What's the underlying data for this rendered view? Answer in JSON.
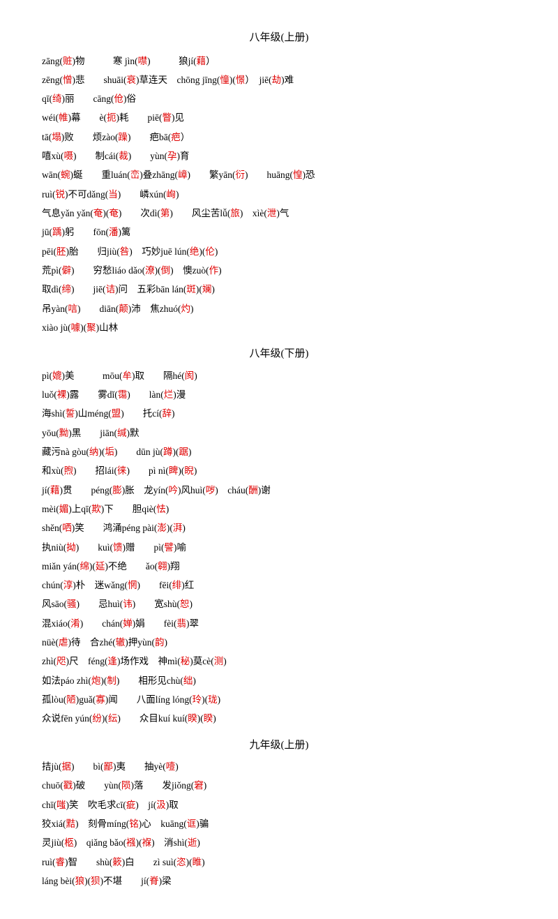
{
  "title1": "八年级(上册)",
  "title2": "八年级(下册)",
  "title3": "九年级(上册)",
  "lines_upper": [
    "zāng(<span class='red'>赃</span>)物　　　寒 jìn(<span class='red'>噤</span>)　　　狼jí(<span class='red'>藉</span>）",
    "zēng(<span class='red'>憎</span>)悲　　shuāi(<span class='red'>衰</span>)草连天　chōng jīng(<span class='red'>憧</span>)(<span class='red'>憬</span>）　jiē(<span class='red'>劫</span>)难",
    "qī(<span class='red'>绮</span>)丽　　cāng(<span class='red'>伧</span>)俗",
    "wéi(<span class='red'>帷</span>)幕　　è(<span class='red'>扼</span>)耗　　piē(<span class='red'>瞥</span>)见",
    "tā(<span class='red'>塌</span>)败　　烦zào(<span class='red'>躁</span>)　　疤bā(<span class='red'>疤</span>）",
    "嘻xù(<span class='red'>嗫</span>)　　制cái(<span class='red'>裁</span>)　　yùn(<span class='red'>孕</span>)育",
    "wān(<span class='red'>蜿</span>)蜒　　重luán(<span class='red'>峦</span>)叠zhāng(<span class='red'>嶂</span>)　　繁yān(<span class='red'>衍</span>)　　huāng(<span class='red'>惶</span>)恐",
    "ruì(<span class='red'>锐</span>)不可dǎng(<span class='red'>当</span>)　　嶙xún(<span class='red'>峋</span>)　",
    "气息yǎn yǎn(<span class='red'>奄</span>)(<span class='red'>奄</span>)　　次dì(<span class='red'>第</span>)　　风尘苦lǚ(<span class='red'>旅</span>)　xìè(<span class='red'>泄</span>)气",
    "jū(<span class='red'>踽</span>)躬　　fōn(<span class='red'>潘</span>)篱",
    "pēi(<span class='red'>胚</span>)胎　　归jiù(<span class='red'>咎</span>)　巧妙juē lún(<span class='red'>绝</span>)(<span class='red'>伦</span>)",
    "荒pì(<span class='red'>僻</span>)　　穷愁liáo dǎo(<span class='red'>潦</span>)(<span class='red'>倒</span>)　懊zuò(<span class='red'>作</span>)",
    "取dì(<span class='red'>缔</span>)　　jiē(<span class='red'>诘</span>)问　五彩bān lán(<span class='red'>斑</span>)(<span class='red'>斓</span>)",
    "吊yàn(<span class='red'>唁</span>)　　diān(<span class='red'>颠</span>)沛　焦zhuó(<span class='red'>灼</span>)",
    "xiào jù(<span class='red'>噱</span>)(<span class='red'>聚</span>)山林"
  ],
  "lines_lower": [
    "pì(<span class='red'>媲</span>)美　　　mōu(<span class='red'>牟</span>)取　　隔hé(<span class='red'>阂</span>)",
    "luǒ(<span class='red'>裸</span>)露　　雾dǐ(<span class='red'>霭</span>)　　làn(<span class='red'>烂</span>)漫",
    "海shì(<span class='red'>誓</span>)山méng(<span class='red'>盟</span>)　　托cí(<span class='red'>辞</span>)",
    "yōu(<span class='red'>黝</span>)黑　　jiān(<span class='red'>缄</span>)默",
    "藏污nà gòu(<span class='red'>纳</span>)(<span class='red'>垢</span>)　　dūn jù(<span class='red'>蹲</span>)(<span class='red'>踞</span>)",
    "和xù(<span class='red'>煦</span>)　　招lái(<span class='red'>徕</span>)　　pì nì(<span class='red'>睥</span>)(<span class='red'>睨</span>)",
    "jí(<span class='red'>藉</span>)贯　　péng(<span class='red'>膨</span>)胀　龙yín(<span class='red'>吟</span>)风huì(<span class='red'>哕</span>)　cháu(<span class='red'>酬</span>)谢",
    "mèi(<span class='red'>媚</span>)上qī(<span class='red'>欺</span>)下　　胆qiè(<span class='red'>怯</span>)",
    "shěn(<span class='red'>哂</span>)笑　　鸿涌péng pài(<span class='red'>澎</span>)(<span class='red'>湃</span>)",
    "执niù(<span class='red'>拗</span>)　　kuì(<span class='red'>馈</span>)赠　　pì(<span class='red'>譬</span>)喻",
    "miǎn yán(<span class='red'>绵</span>)(<span class='red'>延</span>)不绝　　ǎo(<span class='red'>翱</span>)翔",
    "chún(<span class='red'>淳</span>)朴　迷wǎng(<span class='red'>惘</span>)　　fēi(<span class='red'>绯</span>)红",
    "风sāo(<span class='red'>骚</span>)　　忌huì(<span class='red'>讳</span>)　　宽shù(<span class='red'>恕</span>)",
    "混xiáo(<span class='red'>淆</span>)　　chán(<span class='red'>婵</span>)娟　　fèi(<span class='red'>翡</span>)翠",
    "nüè(<span class='red'>虐</span>)待　合zhé(<span class='red'>辙</span>)押yùn(<span class='red'>韵</span>)",
    "zhì(<span class='red'>咫</span>)尺　féng(<span class='red'>逢</span>)场作戏　神mì(<span class='red'>秘</span>)莫cè(<span class='red'>测</span>)",
    "如法páo zhì(<span class='red'>炮</span>)(<span class='red'>制</span>)　　相形见chù(<span class='red'>绌</span>)",
    "孤lòu(<span class='red'>陋</span>)guǎ(<span class='red'>寡</span>)闻　　八面líng lóng(<span class='red'>玲</span>)(<span class='red'>珑</span>)",
    "众说fēn yún(<span class='red'>纷</span>)(<span class='red'>纭</span>)　　众目kuí kuí(<span class='red'>睽</span>)(<span class='red'>睽</span>)"
  ],
  "lines_grade9": [
    "拮jù(<span class='red'>据</span>)　　bì(<span class='red'>鄙</span>)夷　　抽yè(<span class='red'>噎</span>)",
    "chuō(<span class='red'>戳</span>)破　　yùn(<span class='red'>陨</span>)落　　发jiǒng(<span class='red'>窘</span>)",
    "chī(<span class='red'>嗤</span>)笑　吹毛求cī(<span class='red'>疵</span>)　jí(<span class='red'>汲</span>)取",
    "狡xiá(<span class='red'>黠</span>)　刻骨míng(<span class='red'>铭</span>)心　kuāng(<span class='red'>诓</span>)骗",
    "灵jiù(<span class='red'>柩</span>)　qiǎng bǎo(<span class='red'>襁</span>)(<span class='red'>褓</span>)　消shì(<span class='red'>逝</span>)",
    "ruì(<span class='red'>睿</span>)智　　shù(<span class='red'>簌</span>)白　　zì suì(<span class='red'>恣</span>)(<span class='red'>睢</span>)",
    "láng bèi(<span class='red'>狼</span>)(<span class='red'>狈</span>)不堪　　jí(<span class='red'>脊</span>)梁"
  ]
}
